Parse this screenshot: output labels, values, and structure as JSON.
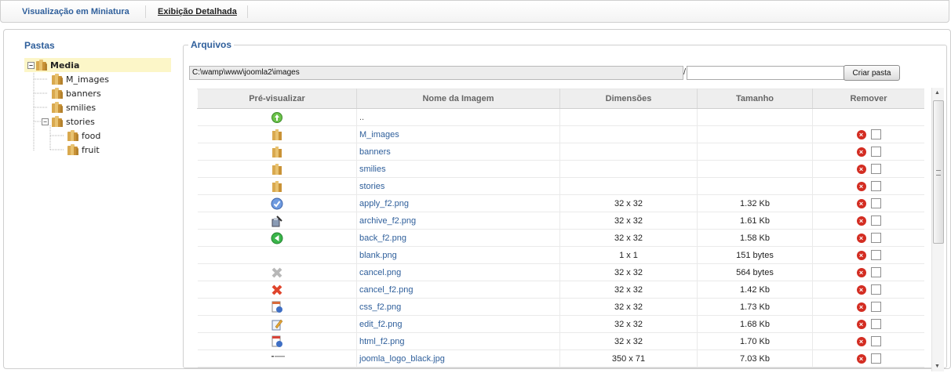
{
  "tabs": {
    "thumbnail_label": "Visualização em Miniatura",
    "detail_label": "Exibição Detalhada"
  },
  "folders_panel": {
    "title": "Pastas",
    "root": "Media",
    "items": [
      "M_images",
      "banners",
      "smilies",
      "stories",
      "food",
      "fruit"
    ]
  },
  "files_panel": {
    "title": "Arquivos",
    "path": "C:\\wamp\\www\\joomla2\\images",
    "slash": "/",
    "new_folder_value": "",
    "create_button": "Criar pasta",
    "columns": [
      "Pré-visualizar",
      "Nome da Imagem",
      "Dimensões",
      "Tamanho",
      "Remover"
    ],
    "rows": [
      {
        "icon": "up-folder-icon",
        "name": "..",
        "dimensions": "",
        "size": "",
        "removable": false
      },
      {
        "icon": "folder-icon",
        "name": "M_images",
        "dimensions": "",
        "size": "",
        "removable": true
      },
      {
        "icon": "folder-icon",
        "name": "banners",
        "dimensions": "",
        "size": "",
        "removable": true
      },
      {
        "icon": "folder-icon",
        "name": "smilies",
        "dimensions": "",
        "size": "",
        "removable": true
      },
      {
        "icon": "folder-icon",
        "name": "stories",
        "dimensions": "",
        "size": "",
        "removable": true
      },
      {
        "icon": "apply-icon",
        "name": "apply_f2.png",
        "dimensions": "32 x 32",
        "size": "1.32 Kb",
        "removable": true
      },
      {
        "icon": "archive-icon",
        "name": "archive_f2.png",
        "dimensions": "32 x 32",
        "size": "1.61 Kb",
        "removable": true
      },
      {
        "icon": "back-icon",
        "name": "back_f2.png",
        "dimensions": "32 x 32",
        "size": "1.58 Kb",
        "removable": true
      },
      {
        "icon": "",
        "name": "blank.png",
        "dimensions": "1 x 1",
        "size": "151 bytes",
        "removable": true
      },
      {
        "icon": "cancel-gray-icon",
        "name": "cancel.png",
        "dimensions": "32 x 32",
        "size": "564 bytes",
        "removable": true
      },
      {
        "icon": "cancel-red-icon",
        "name": "cancel_f2.png",
        "dimensions": "32 x 32",
        "size": "1.42 Kb",
        "removable": true
      },
      {
        "icon": "css-file-icon",
        "name": "css_f2.png",
        "dimensions": "32 x 32",
        "size": "1.73 Kb",
        "removable": true
      },
      {
        "icon": "edit-icon",
        "name": "edit_f2.png",
        "dimensions": "32 x 32",
        "size": "1.68 Kb",
        "removable": true
      },
      {
        "icon": "html-file-icon",
        "name": "html_f2.png",
        "dimensions": "32 x 32",
        "size": "1.70 Kb",
        "removable": true
      },
      {
        "icon": "joomla-logo-thumb-icon",
        "name": "joomla_logo_black.jpg",
        "dimensions": "350 x 71",
        "size": "7.03 Kb",
        "removable": true
      }
    ]
  },
  "colors": {
    "link": "#2f5f9b",
    "selected_folder_bg": "#fcf6c8",
    "delete_red": "#d32d22"
  }
}
